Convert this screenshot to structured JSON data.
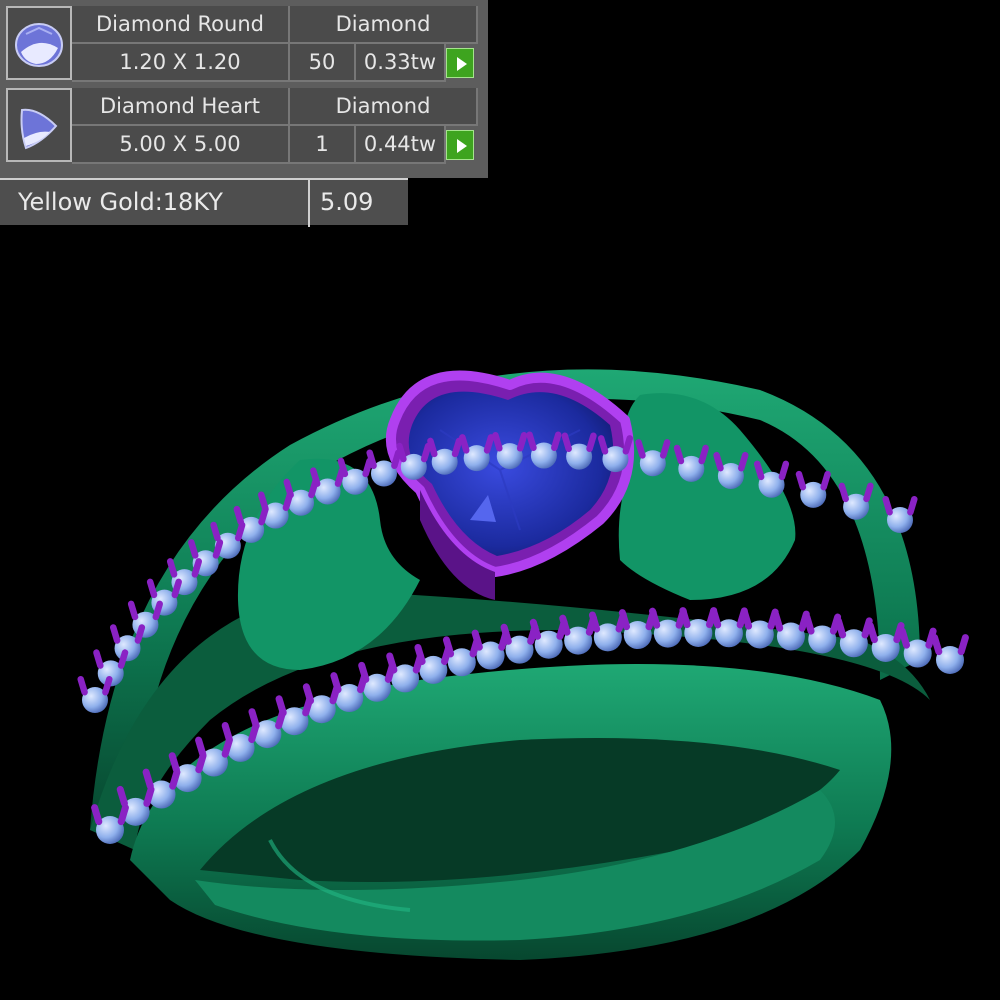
{
  "stones": [
    {
      "icon": "round-diamond-icon",
      "name": "Diamond Round",
      "type": "Diamond",
      "size": "1.20 X 1.20",
      "count": "50",
      "weight": "0.33tw"
    },
    {
      "icon": "heart-diamond-icon",
      "name": "Diamond Heart",
      "type": "Diamond",
      "size": "5.00 X 5.00",
      "count": "1",
      "weight": "0.44tw"
    }
  ],
  "metal": {
    "name": "Yellow Gold:18KY",
    "weight": "5.09"
  },
  "colors": {
    "band": "#148a5f",
    "prongs": "#8a22c4",
    "accent_diamonds": "#a9c3f2",
    "center_stone": "#1c2aa8",
    "panel_bg": "#5d5d5d",
    "button": "#3ea41f"
  }
}
